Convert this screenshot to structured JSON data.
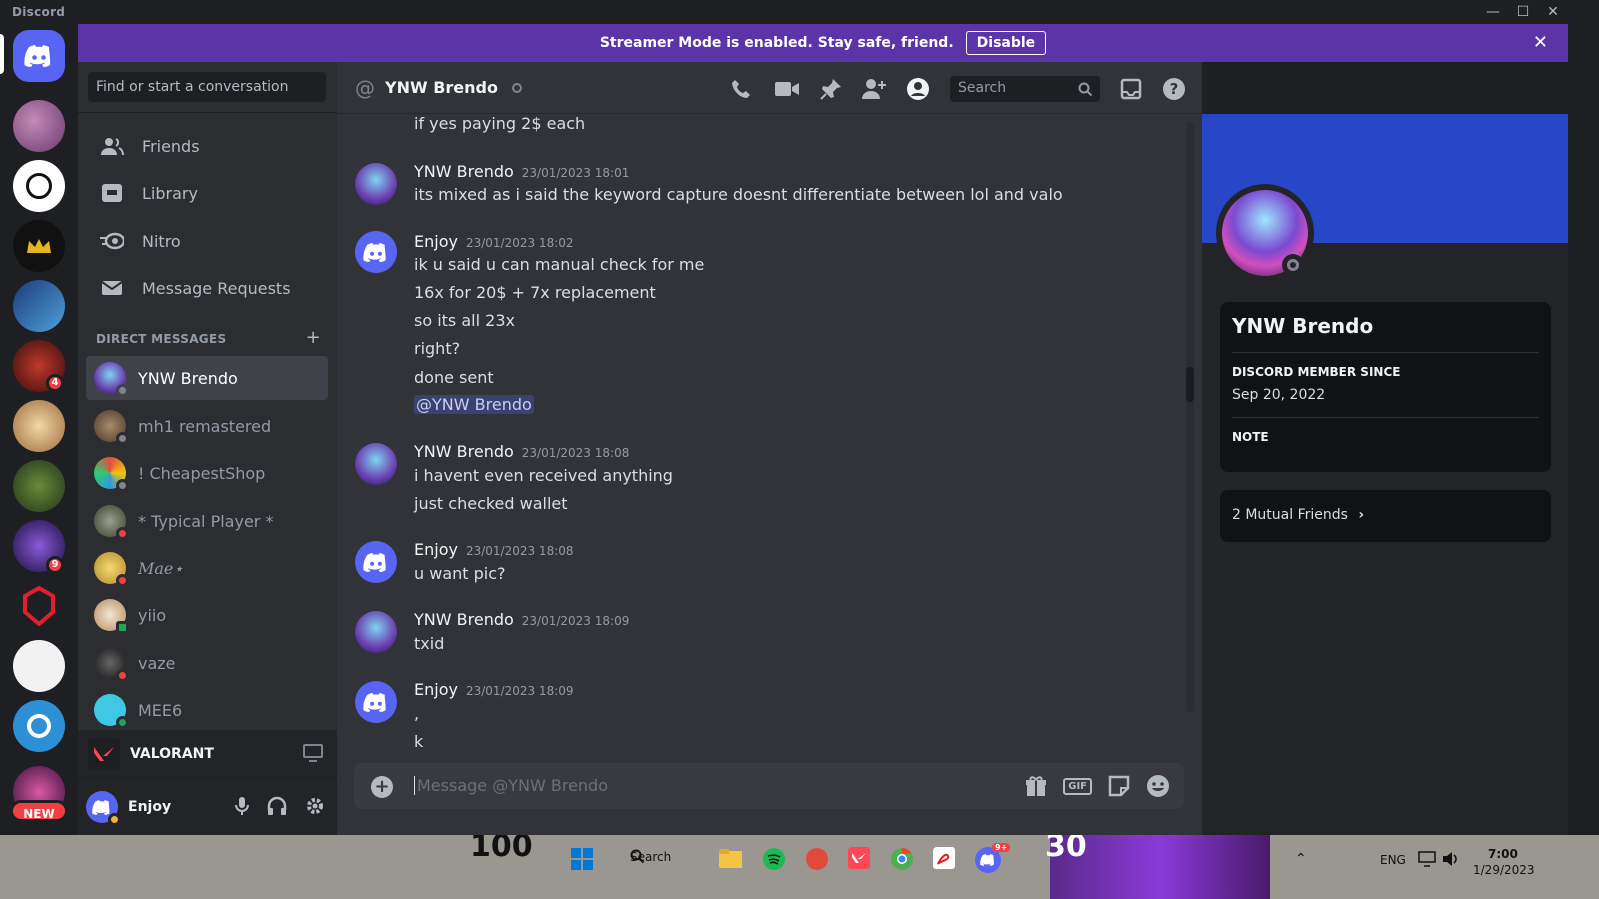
{
  "app": {
    "name": "Discord"
  },
  "window": {
    "minimize": "—",
    "maximize": "☐",
    "close": "✕"
  },
  "banner": {
    "message": "Streamer Mode is enabled. Stay safe, friend.",
    "button": "Disable"
  },
  "guilds": {
    "new_label": "NEW",
    "badges": [
      "4",
      "9"
    ]
  },
  "dm_panel": {
    "search_placeholder": "Find or start a conversation",
    "nav": [
      {
        "label": "Friends",
        "icon": "friends-icon"
      },
      {
        "label": "Library",
        "icon": "library-icon"
      },
      {
        "label": "Nitro",
        "icon": "nitro-icon"
      },
      {
        "label": "Message Requests",
        "icon": "mail-icon"
      }
    ],
    "section_title": "DIRECT MESSAGES",
    "dms": [
      {
        "name": "YNW Brendo",
        "status": "offline",
        "active": true
      },
      {
        "name": "mh1 remastered",
        "status": "offline"
      },
      {
        "name": "! CheapestShop",
        "status": "offline"
      },
      {
        "name": "* Typical Player *",
        "status": "dnd"
      },
      {
        "name": "𝑀𝑎𝑒⋆",
        "status": "dnd"
      },
      {
        "name": "yiio",
        "status": "mobile"
      },
      {
        "name": "vaze",
        "status": "dnd"
      },
      {
        "name": "MEE6",
        "status": "online"
      }
    ],
    "activity": {
      "game": "VALORANT"
    },
    "user": {
      "name": "Enjoy"
    }
  },
  "chat": {
    "recipient": "YNW Brendo",
    "top_partial": "if yes paying 2$ each",
    "groups": [
      {
        "author": "YNW Brendo",
        "time": "23/01/2023 18:01",
        "lines": [
          "its mixed as i said the keyword capture doesnt differentiate between lol and valo"
        ]
      },
      {
        "author": "Enjoy",
        "time": "23/01/2023 18:02",
        "lines": [
          "ik u said u can manual check for me",
          "16x for 20$ + 7x replacement",
          "so its all 23x",
          "right?",
          "done sent",
          "@YNW Brendo"
        ]
      },
      {
        "author": "YNW Brendo",
        "time": "23/01/2023 18:08",
        "lines": [
          "i havent even received anything",
          "just checked wallet"
        ]
      },
      {
        "author": "Enjoy",
        "time": "23/01/2023 18:08",
        "lines": [
          "u want pic?"
        ]
      },
      {
        "author": "YNW Brendo",
        "time": "23/01/2023 18:09",
        "lines": [
          "txid"
        ]
      },
      {
        "author": "Enjoy",
        "time": "23/01/2023 18:09",
        "lines": [
          ",",
          "k"
        ]
      }
    ],
    "composer_placeholder": "Message @YNW Brendo",
    "gif_label": "GIF",
    "search_placeholder": "Search"
  },
  "profile": {
    "name": "YNW Brendo",
    "member_since_label": "DISCORD MEMBER SINCE",
    "member_since": "Sep 20, 2022",
    "note_label": "NOTE",
    "mutual_friends": "2 Mutual Friends"
  },
  "taskbar": {
    "search": "Search",
    "lang": "ENG",
    "time": "7:00",
    "date": "1/29/2023",
    "discord_badge": "9+",
    "game_hud": [
      "100",
      "30"
    ]
  },
  "colors": {
    "accent": "#5865f2",
    "streamer_banner": "#5b34a8",
    "profile_banner": "#2747c8",
    "dnd": "#f23f43",
    "online": "#23a559",
    "offline": "#80848e"
  }
}
